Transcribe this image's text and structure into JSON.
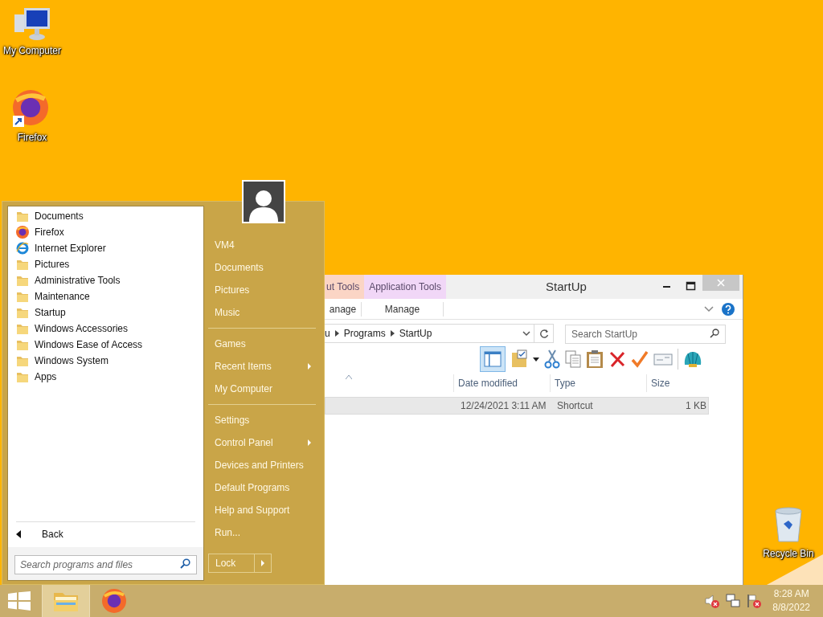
{
  "desktop_icons": [
    {
      "label": "My Computer",
      "kind": "computer"
    },
    {
      "label": "Firefox",
      "kind": "firefox"
    },
    {
      "label": "Recycle Bin",
      "kind": "recycle"
    }
  ],
  "explorer": {
    "title": "StartUp",
    "context_tabs": [
      {
        "label": "ut Tools",
        "color": "#fbd5c5"
      },
      {
        "label": "Application Tools",
        "color": "#f1d7f7"
      }
    ],
    "ribbon_tabs": [
      "anage",
      "Manage"
    ],
    "breadcrumbs": [
      "u",
      "Programs",
      "StartUp"
    ],
    "search": {
      "placeholder": "Search StartUp"
    },
    "columns": [
      "Date modified",
      "Type",
      "Size"
    ],
    "rows": [
      {
        "date": "12/24/2021 3:11 AM",
        "type": "Shortcut",
        "size": "1 KB",
        "selected": true
      }
    ]
  },
  "start_menu": {
    "programs": [
      {
        "label": "Documents",
        "kind": "folder"
      },
      {
        "label": "Firefox",
        "kind": "firefox"
      },
      {
        "label": "Internet Explorer",
        "kind": "browser"
      },
      {
        "label": "Pictures",
        "kind": "folder"
      },
      {
        "label": "Administrative Tools",
        "kind": "folder"
      },
      {
        "label": "Maintenance",
        "kind": "folder"
      },
      {
        "label": "Startup",
        "kind": "folder"
      },
      {
        "label": "Windows Accessories",
        "kind": "folder"
      },
      {
        "label": "Windows Ease of Access",
        "kind": "folder"
      },
      {
        "label": "Windows System",
        "kind": "folder"
      },
      {
        "label": "Apps",
        "kind": "folder"
      }
    ],
    "back": "Back",
    "search": {
      "placeholder": "Search programs and files"
    },
    "place_groups": [
      [
        {
          "label": "VM4",
          "submenu": false
        },
        {
          "label": "Documents",
          "submenu": false
        },
        {
          "label": "Pictures",
          "submenu": false
        },
        {
          "label": "Music",
          "submenu": false
        }
      ],
      [
        {
          "label": "Games",
          "submenu": false
        },
        {
          "label": "Recent Items",
          "submenu": true
        },
        {
          "label": "My Computer",
          "submenu": false
        }
      ],
      [
        {
          "label": "Settings",
          "submenu": false
        },
        {
          "label": "Control Panel",
          "submenu": true
        },
        {
          "label": "Devices and Printers",
          "submenu": false
        },
        {
          "label": "Default Programs",
          "submenu": false
        },
        {
          "label": "Help and Support",
          "submenu": false
        },
        {
          "label": "Run...",
          "submenu": false
        }
      ]
    ],
    "power": {
      "label": "Lock"
    }
  },
  "taskbar": {
    "buttons": [
      {
        "kind": "explorer",
        "selected": true
      },
      {
        "kind": "firefox",
        "selected": false
      }
    ],
    "time": "8:28 AM",
    "date": "8/8/2022"
  }
}
